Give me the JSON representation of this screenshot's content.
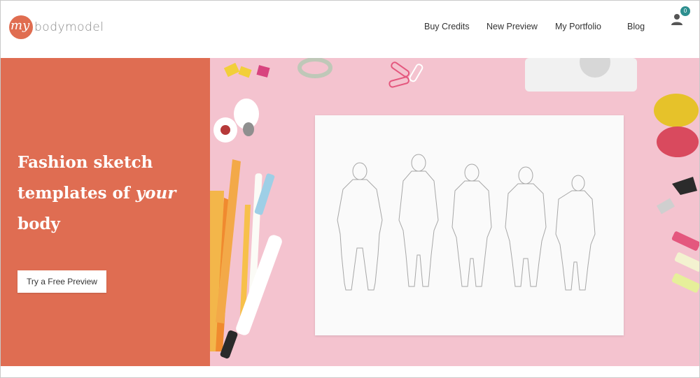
{
  "header": {
    "logo_my": "my",
    "logo_text": "bodymodel",
    "nav": [
      {
        "label": "Buy Credits"
      },
      {
        "label": "New Preview"
      },
      {
        "label": "My Portfolio"
      },
      {
        "label": "Blog"
      }
    ],
    "cart_count": "0"
  },
  "hero": {
    "headline_part1": "Fashion sketch templates of ",
    "headline_em": "your",
    "headline_part2": " body",
    "cta_label": "Try a Free Preview"
  },
  "colors": {
    "brand": "#df6d52",
    "photo_background": "#f4c3cf",
    "badge": "#2d8f8f"
  },
  "icons": [
    "user-icon",
    "body-figure-sketch"
  ]
}
